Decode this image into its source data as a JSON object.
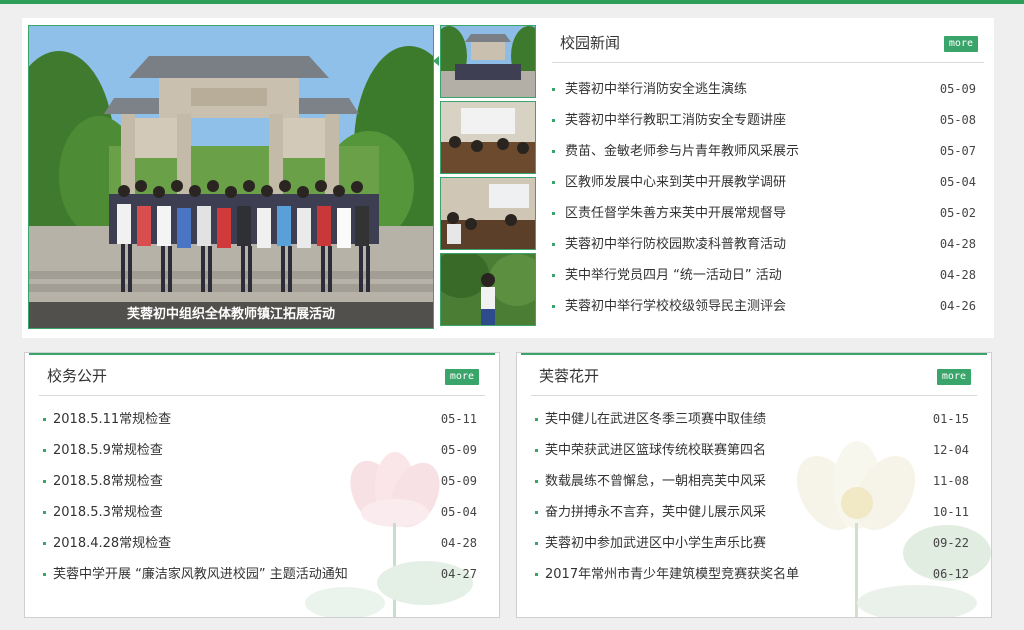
{
  "slideshow": {
    "caption": "芙蓉初中组织全体教师镇江拓展活动"
  },
  "campus_news": {
    "title": "校园新闻",
    "more_label": "more",
    "items": [
      {
        "text": "芙蓉初中举行消防安全逃生演练",
        "date": "05-09"
      },
      {
        "text": "芙蓉初中举行教职工消防安全专题讲座",
        "date": "05-08"
      },
      {
        "text": "费苗、金敏老师参与片青年教师风采展示",
        "date": "05-07"
      },
      {
        "text": "区教师发展中心来到芙中开展教学调研",
        "date": "05-04"
      },
      {
        "text": "区责任督学朱善方来芙中开展常规督导",
        "date": "05-02"
      },
      {
        "text": "芙蓉初中举行防校园欺凌科普教育活动",
        "date": "04-28"
      },
      {
        "text": "芙中举行党员四月 “统一活动日” 活动",
        "date": "04-28"
      },
      {
        "text": "芙蓉初中举行学校校级领导民主测评会",
        "date": "04-26"
      }
    ]
  },
  "school_affairs": {
    "title": "校务公开",
    "more_label": "more",
    "items": [
      {
        "text": "2018.5.11常规检查",
        "date": "05-11"
      },
      {
        "text": "2018.5.9常规检查",
        "date": "05-09"
      },
      {
        "text": "2018.5.8常规检查",
        "date": "05-09"
      },
      {
        "text": "2018.5.3常规检查",
        "date": "05-04"
      },
      {
        "text": "2018.4.28常规检查",
        "date": "04-28"
      },
      {
        "text": "芙蓉中学开展 “廉洁家风教风进校园” 主题活动通知",
        "date": "04-27"
      }
    ]
  },
  "furong_bloom": {
    "title": "芙蓉花开",
    "more_label": "more",
    "items": [
      {
        "text": "芙中健儿在武进区冬季三项赛中取佳绩",
        "date": "01-15"
      },
      {
        "text": "芙中荣获武进区篮球传统校联赛第四名",
        "date": "12-04"
      },
      {
        "text": "数载晨练不曾懈怠，一朝相亮芙中风采",
        "date": "11-08"
      },
      {
        "text": "奋力拼搏永不言弃，芙中健儿展示风采",
        "date": "10-11"
      },
      {
        "text": "芙蓉初中参加武进区中小学生声乐比赛",
        "date": "09-22"
      },
      {
        "text": "2017年常州市青少年建筑模型竞赛获奖名单",
        "date": "06-12"
      }
    ]
  },
  "colors": {
    "accent": "#3aa56a",
    "topbar": "#2e9e5a",
    "background": "#efefef"
  }
}
